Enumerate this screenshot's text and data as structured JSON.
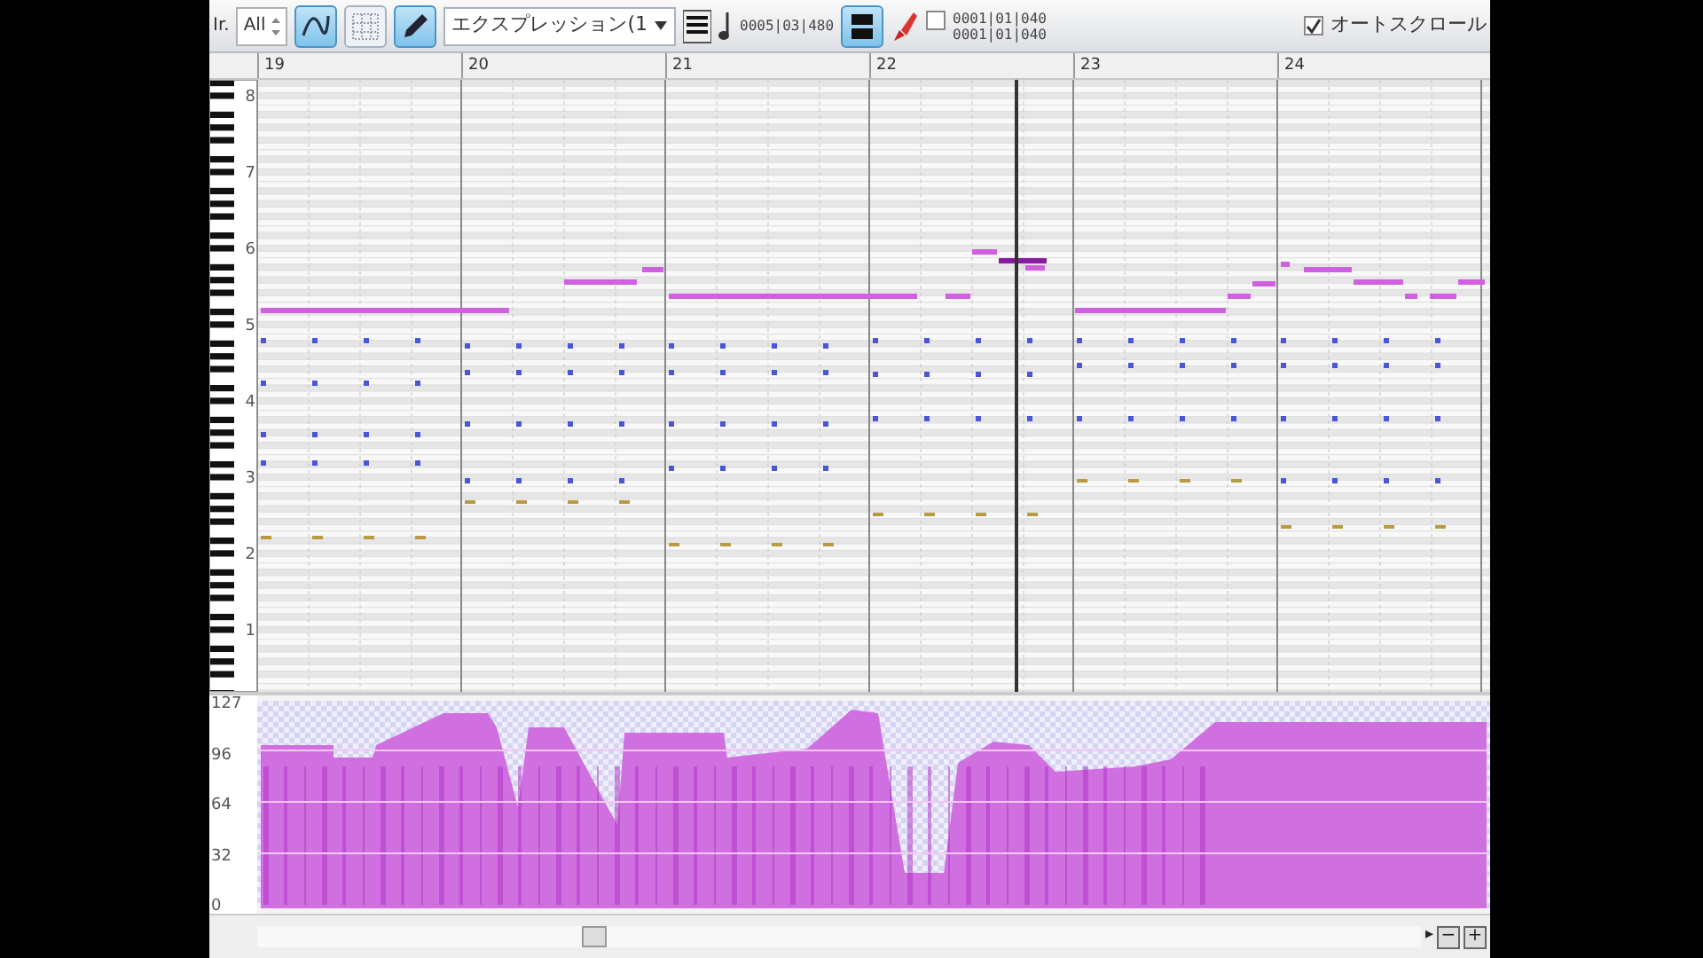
{
  "toolbar": {
    "cut_label": "Ir.",
    "track": "All",
    "tools": [
      {
        "kind": "curve",
        "selected": true
      },
      {
        "kind": "grid",
        "selected": false
      },
      {
        "kind": "pencil",
        "selected": true
      }
    ],
    "controller": "エクスプレッション(1",
    "position": "0005|03|480",
    "view_toggle": {
      "selected": true
    },
    "range": {
      "checked": false,
      "start": "0001|01|040",
      "end": "0001|01|040"
    },
    "autoscroll": {
      "label": "オートスクロール",
      "checked": true
    }
  },
  "ruler": [
    "19",
    "20",
    "21",
    "22",
    "23",
    "24"
  ],
  "octaves": [
    "8",
    "7",
    "6",
    "5",
    "4",
    "3",
    "2",
    "1"
  ],
  "lane": {
    "ticks": [
      "127",
      "96",
      "64",
      "32",
      "0"
    ]
  },
  "scroll": {
    "arrow": "▸",
    "zoom_buttons": [
      "−",
      "+"
    ]
  }
}
